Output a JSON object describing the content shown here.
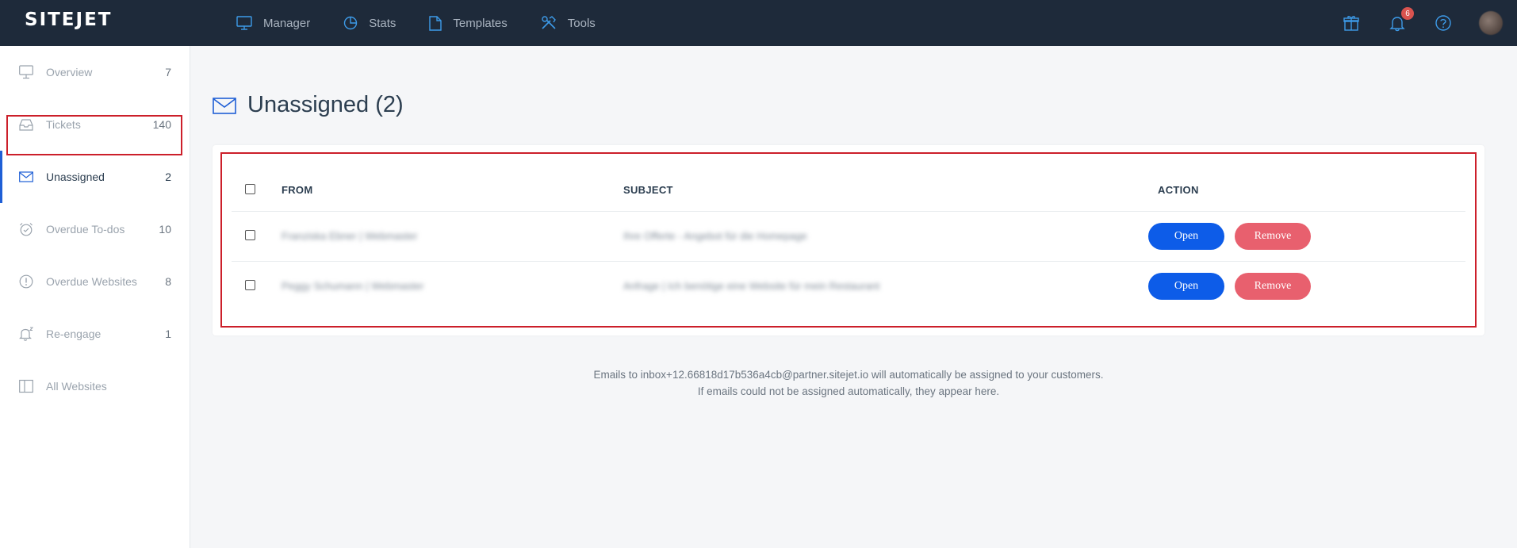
{
  "app": {
    "logo": "SITEJET"
  },
  "nav": [
    {
      "label": "Manager",
      "icon": "monitor-icon"
    },
    {
      "label": "Stats",
      "icon": "pie-chart-icon"
    },
    {
      "label": "Templates",
      "icon": "document-icon"
    },
    {
      "label": "Tools",
      "icon": "tools-icon"
    }
  ],
  "header_icons": {
    "gift": "gift-icon",
    "notifications": {
      "icon": "bell-icon",
      "badge": "6"
    },
    "help": "help-icon"
  },
  "sidebar": {
    "items": [
      {
        "label": "Overview",
        "count": "7",
        "icon": "monitor-icon"
      },
      {
        "label": "Tickets",
        "count": "140",
        "icon": "inbox-icon"
      },
      {
        "label": "Unassigned",
        "count": "2",
        "icon": "mail-icon",
        "active": true
      },
      {
        "label": "Overdue To-dos",
        "count": "10",
        "icon": "alarm-clock-icon"
      },
      {
        "label": "Overdue Websites",
        "count": "8",
        "icon": "alert-circle-icon"
      },
      {
        "label": "Re-engage",
        "count": "1",
        "icon": "bell-z-icon"
      },
      {
        "label": "All Websites",
        "count": "",
        "icon": "columns-icon"
      }
    ]
  },
  "page": {
    "title": "Unassigned (2)"
  },
  "table": {
    "headers": {
      "from": "FROM",
      "subject": "SUBJECT",
      "action": "ACTION"
    },
    "rows": [
      {
        "from": "Franziska Ebner | Webmaster",
        "subject": "Ihre Offerte - Angebot für die Homepage",
        "open": "Open",
        "remove": "Remove"
      },
      {
        "from": "Peggy Schumann | Webmaster",
        "subject": "Anfrage | Ich benötige eine Website für mein Restaurant",
        "open": "Open",
        "remove": "Remove"
      }
    ]
  },
  "footer": {
    "line1": "Emails to inbox+12.66818d17b536a4cb@partner.sitejet.io will automatically be assigned to your customers.",
    "line2": "If emails could not be assigned automatically, they appear here."
  },
  "colors": {
    "topbar": "#1e2a3a",
    "accent": "#1f5fd6",
    "open": "#0d5ce8",
    "remove": "#e8606e",
    "icon": "#3d9be9"
  }
}
